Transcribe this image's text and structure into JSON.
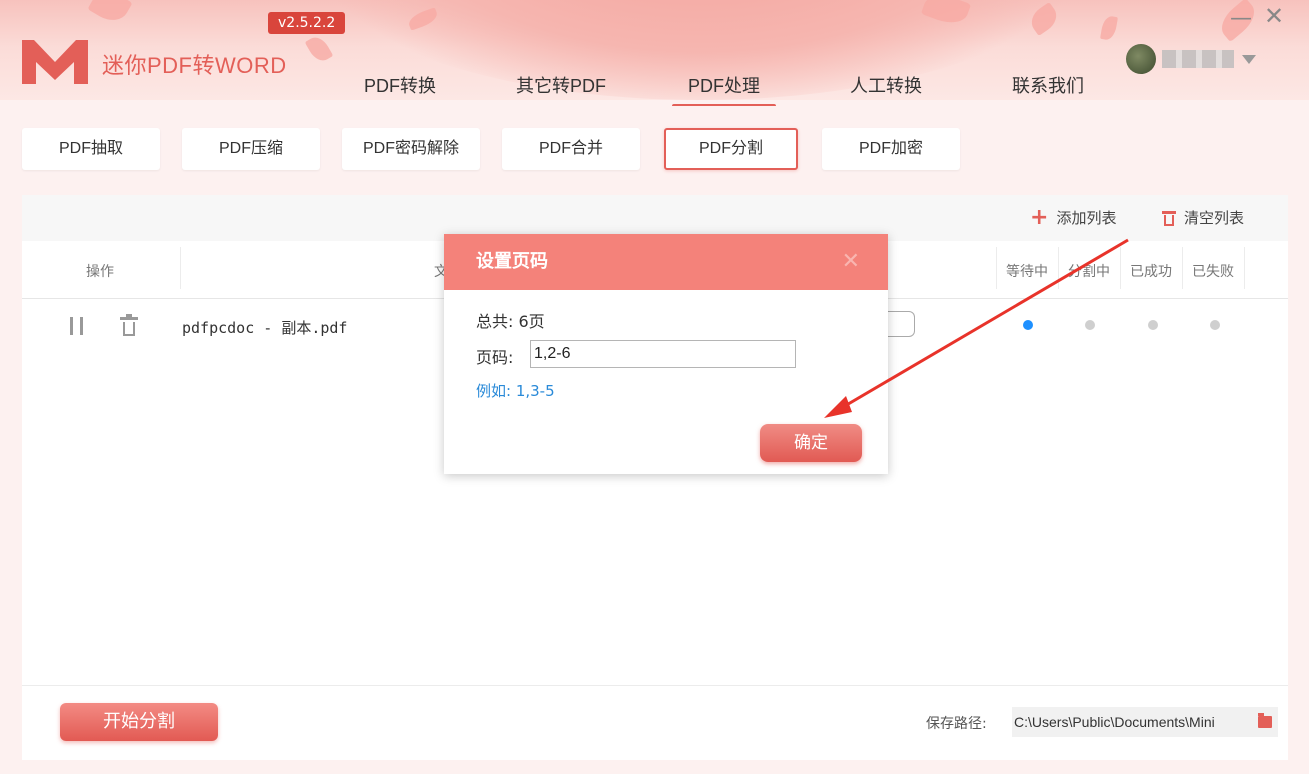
{
  "app": {
    "title": "迷你PDF转WORD",
    "version": "v2.5.2.2",
    "window_controls": {
      "minimize": "—",
      "close": "✕"
    }
  },
  "nav": {
    "items": [
      "PDF转换",
      "其它转PDF",
      "PDF处理",
      "人工转换",
      "联系我们"
    ],
    "active": "PDF处理"
  },
  "subtabs": {
    "items": [
      "PDF抽取",
      "PDF压缩",
      "PDF密码解除",
      "PDF合并",
      "PDF分割",
      "PDF加密"
    ],
    "active": "PDF分割"
  },
  "toolbar": {
    "add_list": "添加列表",
    "clear_list": "清空列表"
  },
  "table": {
    "headers": {
      "actions": "操作",
      "file": "文",
      "waiting": "等待中",
      "splitting": "分割中",
      "success": "已成功",
      "failed": "已失败"
    },
    "rows": [
      {
        "filename": "pdfpcdoc - 副本.pdf",
        "status": "等待中"
      }
    ]
  },
  "footer": {
    "start_button": "开始分割",
    "save_label": "保存路径:",
    "save_path": "C:\\Users\\Public\\Documents\\Mini"
  },
  "dialog": {
    "title": "设置页码",
    "close": "✕",
    "total": "总共: 6页",
    "page_label": "页码:",
    "page_value": "1,2-6",
    "example": "例如: 1,3-5",
    "ok": "确定"
  },
  "colors": {
    "accent": "#e35f58",
    "dialog_header": "#f4827a",
    "status_active_dot": "#1e90ff",
    "example_text": "#2a8ad8"
  },
  "icons": [
    "logo-m-icon",
    "plus-icon",
    "trash-icon",
    "pause-icon",
    "folder-icon",
    "dropdown-caret-icon",
    "close-icon",
    "minimize-icon"
  ]
}
